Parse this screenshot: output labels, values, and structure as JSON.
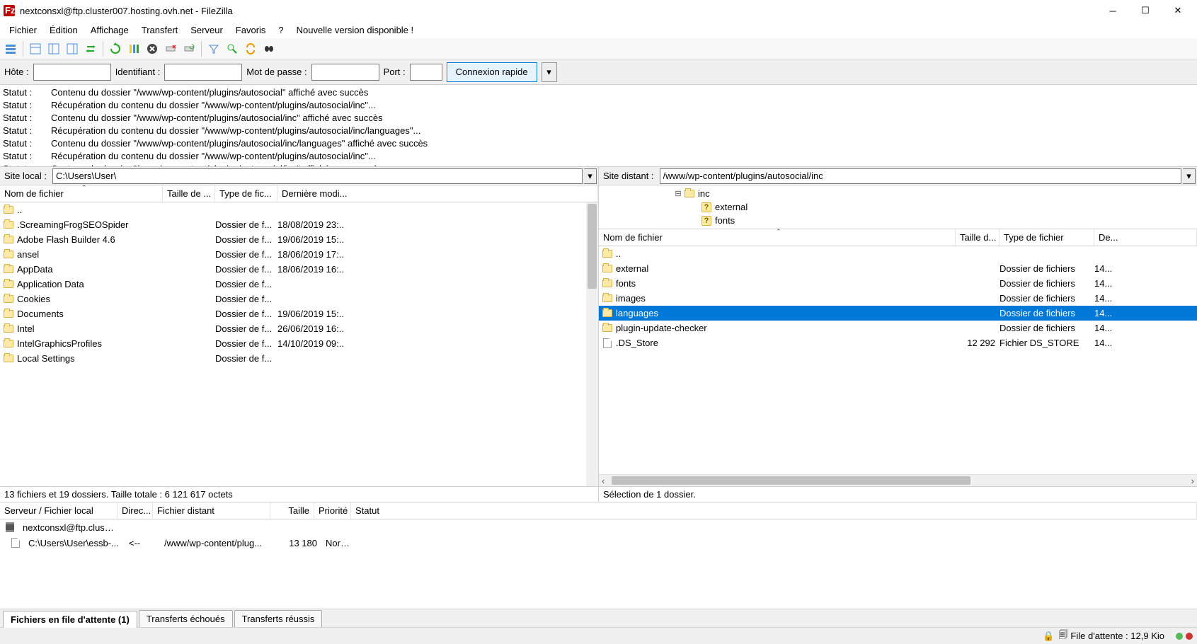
{
  "window": {
    "title": "nextconsxl@ftp.cluster007.hosting.ovh.net - FileZilla"
  },
  "menu": [
    "Fichier",
    "Édition",
    "Affichage",
    "Transfert",
    "Serveur",
    "Favoris",
    "?",
    "Nouvelle version disponible !"
  ],
  "quickconnect": {
    "host_label": "Hôte :",
    "user_label": "Identifiant :",
    "pass_label": "Mot de passe :",
    "port_label": "Port :",
    "button": "Connexion rapide"
  },
  "log": [
    {
      "label": "Statut :",
      "text": "Contenu du dossier \"/www/wp-content/plugins/autosocial\" affiché avec succès"
    },
    {
      "label": "Statut :",
      "text": "Récupération du contenu du dossier \"/www/wp-content/plugins/autosocial/inc\"..."
    },
    {
      "label": "Statut :",
      "text": "Contenu du dossier \"/www/wp-content/plugins/autosocial/inc\" affiché avec succès"
    },
    {
      "label": "Statut :",
      "text": "Récupération du contenu du dossier \"/www/wp-content/plugins/autosocial/inc/languages\"..."
    },
    {
      "label": "Statut :",
      "text": "Contenu du dossier \"/www/wp-content/plugins/autosocial/inc/languages\" affiché avec succès"
    },
    {
      "label": "Statut :",
      "text": "Récupération du contenu du dossier \"/www/wp-content/plugins/autosocial/inc\"..."
    },
    {
      "label": "Statut :",
      "text": "Contenu du dossier \"/www/wp-content/plugins/autosocial/inc\" affiché avec succès"
    }
  ],
  "local": {
    "label": "Site local :",
    "path": "C:\\Users\\User\\",
    "columns": {
      "name": "Nom de fichier",
      "size": "Taille de ...",
      "type": "Type de fic...",
      "modified": "Dernière modi..."
    },
    "rows": [
      {
        "name": "..",
        "size": "",
        "type": "",
        "modified": "",
        "icon": "folder"
      },
      {
        "name": ".ScreamingFrogSEOSpider",
        "size": "",
        "type": "Dossier de f...",
        "modified": "18/08/2019 23:..",
        "icon": "folder"
      },
      {
        "name": "Adobe Flash Builder 4.6",
        "size": "",
        "type": "Dossier de f...",
        "modified": "19/06/2019 15:..",
        "icon": "folder"
      },
      {
        "name": "ansel",
        "size": "",
        "type": "Dossier de f...",
        "modified": "18/06/2019 17:..",
        "icon": "folder"
      },
      {
        "name": "AppData",
        "size": "",
        "type": "Dossier de f...",
        "modified": "18/06/2019 16:..",
        "icon": "folder"
      },
      {
        "name": "Application Data",
        "size": "",
        "type": "Dossier de f...",
        "modified": "",
        "icon": "folder"
      },
      {
        "name": "Cookies",
        "size": "",
        "type": "Dossier de f...",
        "modified": "",
        "icon": "folder"
      },
      {
        "name": "Documents",
        "size": "",
        "type": "Dossier de f...",
        "modified": "19/06/2019 15:..",
        "icon": "folder"
      },
      {
        "name": "Intel",
        "size": "",
        "type": "Dossier de f...",
        "modified": "26/06/2019 16:..",
        "icon": "folder"
      },
      {
        "name": "IntelGraphicsProfiles",
        "size": "",
        "type": "Dossier de f...",
        "modified": "14/10/2019 09:..",
        "icon": "folder"
      },
      {
        "name": "Local Settings",
        "size": "",
        "type": "Dossier de f...",
        "modified": "",
        "icon": "folder"
      }
    ],
    "status": "13 fichiers et 19 dossiers. Taille totale : 6 121 617 octets"
  },
  "remote": {
    "label": "Site distant :",
    "path": "/www/wp-content/plugins/autosocial/inc",
    "tree": [
      {
        "indent": 104,
        "exp": "⊟",
        "name": "inc",
        "icon": "folder"
      },
      {
        "indent": 128,
        "exp": "",
        "name": "external",
        "icon": "q"
      },
      {
        "indent": 128,
        "exp": "",
        "name": "fonts",
        "icon": "q"
      }
    ],
    "columns": {
      "name": "Nom de fichier",
      "size": "Taille d...",
      "type": "Type de fichier",
      "modified": "De..."
    },
    "rows": [
      {
        "name": "..",
        "size": "",
        "type": "",
        "modified": "",
        "icon": "folder",
        "sel": false
      },
      {
        "name": "external",
        "size": "",
        "type": "Dossier de fichiers",
        "modified": "14...",
        "icon": "folder",
        "sel": false
      },
      {
        "name": "fonts",
        "size": "",
        "type": "Dossier de fichiers",
        "modified": "14...",
        "icon": "folder",
        "sel": false
      },
      {
        "name": "images",
        "size": "",
        "type": "Dossier de fichiers",
        "modified": "14...",
        "icon": "folder",
        "sel": false
      },
      {
        "name": "languages",
        "size": "",
        "type": "Dossier de fichiers",
        "modified": "14...",
        "icon": "folder",
        "sel": true
      },
      {
        "name": "plugin-update-checker",
        "size": "",
        "type": "Dossier de fichiers",
        "modified": "14...",
        "icon": "folder",
        "sel": false
      },
      {
        "name": ".DS_Store",
        "size": "12 292",
        "type": "Fichier DS_STORE",
        "modified": "14...",
        "icon": "file",
        "sel": false
      }
    ],
    "status": "Sélection de 1 dossier."
  },
  "queue": {
    "columns": {
      "server": "Serveur / Fichier local",
      "dir": "Direc...",
      "remote": "Fichier distant",
      "size": "Taille",
      "prio": "Priorité",
      "status": "Statut"
    },
    "rows": [
      {
        "kind": "server",
        "server": "nextconsxl@ftp.cluste...",
        "dir": "",
        "remote": "",
        "size": "",
        "prio": "",
        "status": ""
      },
      {
        "kind": "file",
        "server": "C:\\Users\\User\\essb-...",
        "dir": "<--",
        "remote": "/www/wp-content/plug...",
        "size": "13 180",
        "prio": "Norm...",
        "status": ""
      }
    ],
    "tabs": {
      "queued": "Fichiers en file d'attente (1)",
      "failed": "Transferts échoués",
      "ok": "Transferts réussis"
    }
  },
  "status": {
    "queue_label": "File d'attente : 12,9 Kio"
  }
}
